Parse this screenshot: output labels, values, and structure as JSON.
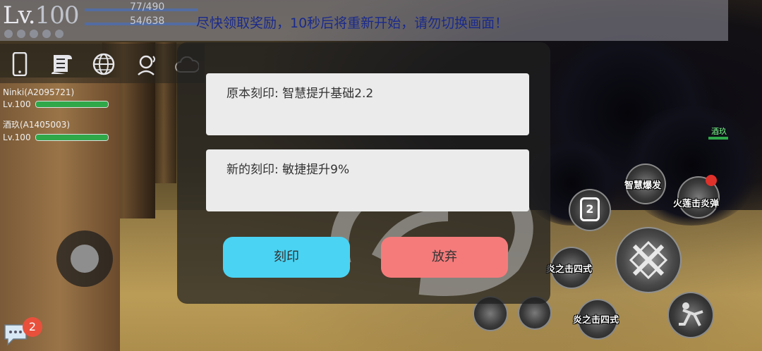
{
  "hud": {
    "level_prefix": "Lv.",
    "level_value": "100",
    "stat_1": "77/490",
    "stat_2": "54/638",
    "notice": "尽快领取奖励，10秒后将重新开始，请勿切换画面！"
  },
  "party": [
    {
      "name": "Ninki(A2095721)",
      "level": "Lv.100",
      "hp_fraction": 1.0
    },
    {
      "name": "酒玖(A1405003)",
      "level": "Lv.100",
      "hp_fraction": 1.0
    }
  ],
  "icons": [
    "phone-icon",
    "scroll-icon",
    "globe-icon",
    "voice-chat-icon",
    "cloud-icon"
  ],
  "dialog": {
    "original_label": "原本刻印: 智慧提升基础2.2",
    "new_label": "新的刻印: 敏捷提升9%",
    "imprint_button": "刻印",
    "abandon_button": "放弃"
  },
  "skills": {
    "wisdom_burst": "智慧爆发",
    "fire_lotus": "火莲击炎弹",
    "flame_strike_top": "炎之击四式",
    "flame_strike_bottom": "炎之击四式",
    "slot_number": "2"
  },
  "ally": {
    "name": "酒玖"
  },
  "chat": {
    "unread": "2"
  },
  "colors": {
    "imprint_button": "#4ad3f3",
    "abandon_button": "#f57b7b",
    "notice_text": "#1a2a8c",
    "hp_bar": "#2fa84a",
    "badge": "#e8503c"
  }
}
